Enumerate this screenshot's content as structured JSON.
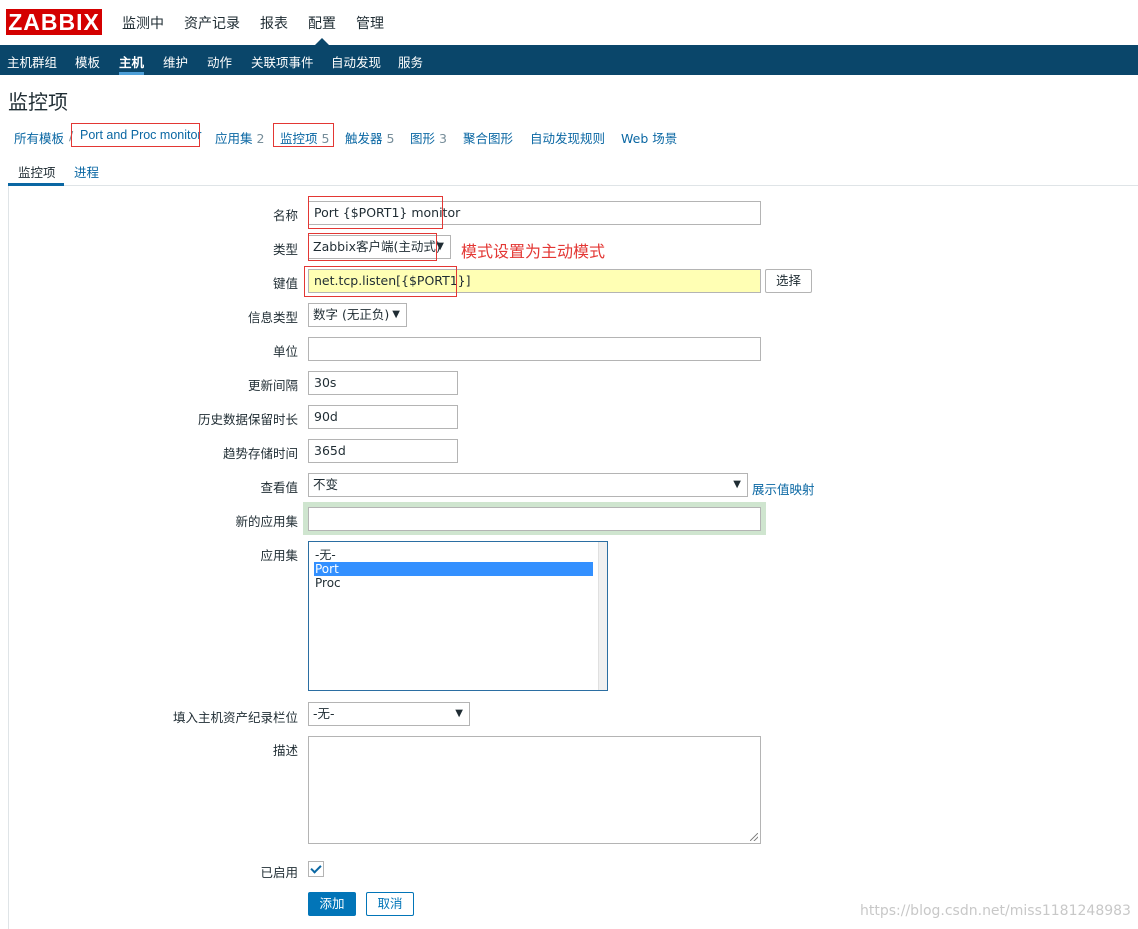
{
  "logo": "ZABBIX",
  "top_menu": [
    "监测中",
    "资产记录",
    "报表",
    "配置",
    "管理"
  ],
  "sub_menu": [
    "主机群组",
    "模板",
    "主机",
    "维护",
    "动作",
    "关联项事件",
    "自动发现",
    "服务"
  ],
  "sub_menu_active": "主机",
  "page_title": "监控项",
  "breadcrumb": {
    "all_templates": "所有模板",
    "sep": "/",
    "template": "Port and Proc monitor",
    "applications": "应用集",
    "applications_count": "2",
    "items": "监控项",
    "items_count": "5",
    "triggers": "触发器",
    "triggers_count": "5",
    "graphs": "图形",
    "graphs_count": "3",
    "screens": "聚合图形",
    "discovery": "自动发现规则",
    "web": "Web 场景"
  },
  "tabs": [
    "监控项",
    "进程"
  ],
  "form": {
    "name_label": "名称",
    "name_value": "Port {$PORT1} monitor",
    "type_label": "类型",
    "type_value": "Zabbix客户端(主动式)",
    "annotation": "模式设置为主动模式",
    "key_label": "键值",
    "key_value": "net.tcp.listen[{$PORT1}]",
    "select_button": "选择",
    "info_type_label": "信息类型",
    "info_type_value": "数字 (无正负)",
    "units_label": "单位",
    "units_value": "",
    "interval_label": "更新间隔",
    "interval_value": "30s",
    "history_label": "历史数据保留时长",
    "history_value": "90d",
    "trends_label": "趋势存储时间",
    "trends_value": "365d",
    "show_value_label": "查看值",
    "show_value_value": "不变",
    "show_value_link": "展示值映射",
    "new_app_label": "新的应用集",
    "new_app_value": "",
    "apps_label": "应用集",
    "apps_options": [
      "-无-",
      "Port",
      "Proc"
    ],
    "apps_selected": "Port",
    "inventory_label": "填入主机资产纪录栏位",
    "inventory_value": "-无-",
    "desc_label": "描述",
    "enabled_label": "已启用",
    "add_button": "添加",
    "cancel_button": "取消"
  },
  "watermark": "https://blog.csdn.net/miss1181248983",
  "colors": {
    "header": "#0a466a",
    "link": "#0a67a3",
    "primary_button": "#0275b8",
    "highlight_box": "#e33734",
    "key_field_bg": "#ffffb4",
    "selected_option": "#3390ff"
  }
}
